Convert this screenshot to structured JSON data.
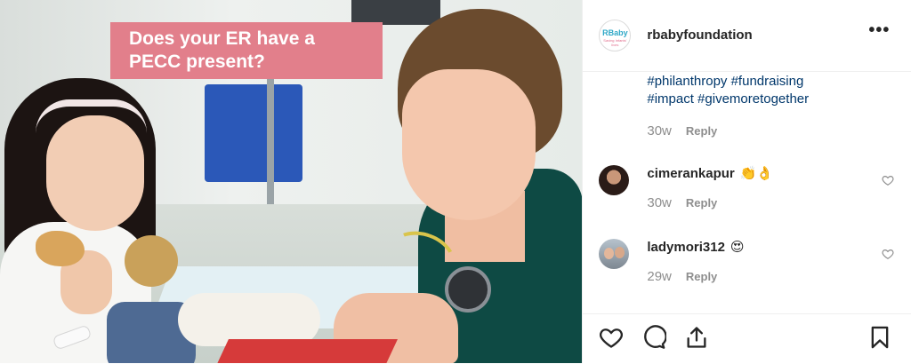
{
  "photo": {
    "caption": "Does your ER have a PECC present?"
  },
  "post": {
    "username": "rbabyfoundation",
    "logo_text": "RBaby",
    "logo_tagline": "Saving Infants' lives",
    "more_label": "•••"
  },
  "caption_comment": {
    "tags_line1": "#philanthropy #fundraising",
    "tags_line2": "#impact #givemoretogether",
    "time": "30w",
    "reply": "Reply"
  },
  "comments": [
    {
      "username": "cimerankapur",
      "emoji": "👏👌",
      "time": "30w",
      "reply": "Reply"
    },
    {
      "username": "ladymori312",
      "emoji": "😍",
      "time": "29w",
      "reply": "Reply"
    }
  ],
  "actions": [
    "like-icon",
    "comment-icon",
    "share-icon",
    "save-icon"
  ],
  "colors": {
    "caption_bg": "#e27f8b",
    "hashtag": "#00376b",
    "meta": "#8e8e8e",
    "scrubs": "#0e4a44"
  }
}
